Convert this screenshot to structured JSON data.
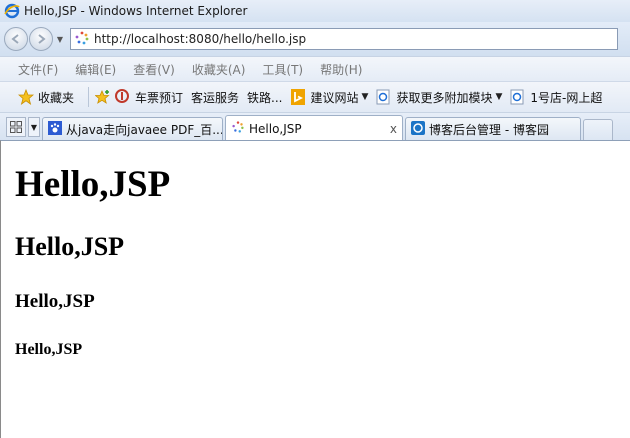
{
  "window": {
    "title": "Hello,JSP - Windows Internet Explorer"
  },
  "address": {
    "url": "http://localhost:8080/hello/hello.jsp"
  },
  "menubar": {
    "items": [
      "文件(F)",
      "编辑(E)",
      "查看(V)",
      "收藏夹(A)",
      "工具(T)",
      "帮助(H)"
    ]
  },
  "favorites": {
    "label": "收藏夹",
    "items": [
      "车票预订",
      "客运服务",
      "铁路...",
      "建议网站",
      "获取更多附加模块",
      "1号店-网上超"
    ]
  },
  "tabs": [
    {
      "label": "从java走向javaee PDF_百..."
    },
    {
      "label": "Hello,JSP",
      "close": "x"
    },
    {
      "label": "博客后台管理 - 博客园"
    }
  ],
  "content": {
    "h1": "Hello,JSP",
    "h2": "Hello,JSP",
    "h3": "Hello,JSP",
    "h4": "Hello,JSP"
  },
  "icons": {
    "ie": "ie-logo-icon",
    "back": "back-arrow-icon",
    "forward": "forward-arrow-icon",
    "loading": "loading-spinner-icon",
    "star": "star-icon",
    "add_fav": "add-favorite-icon"
  },
  "colors": {
    "chrome": "#dfe9f5",
    "accent": "#1f5fbf"
  }
}
